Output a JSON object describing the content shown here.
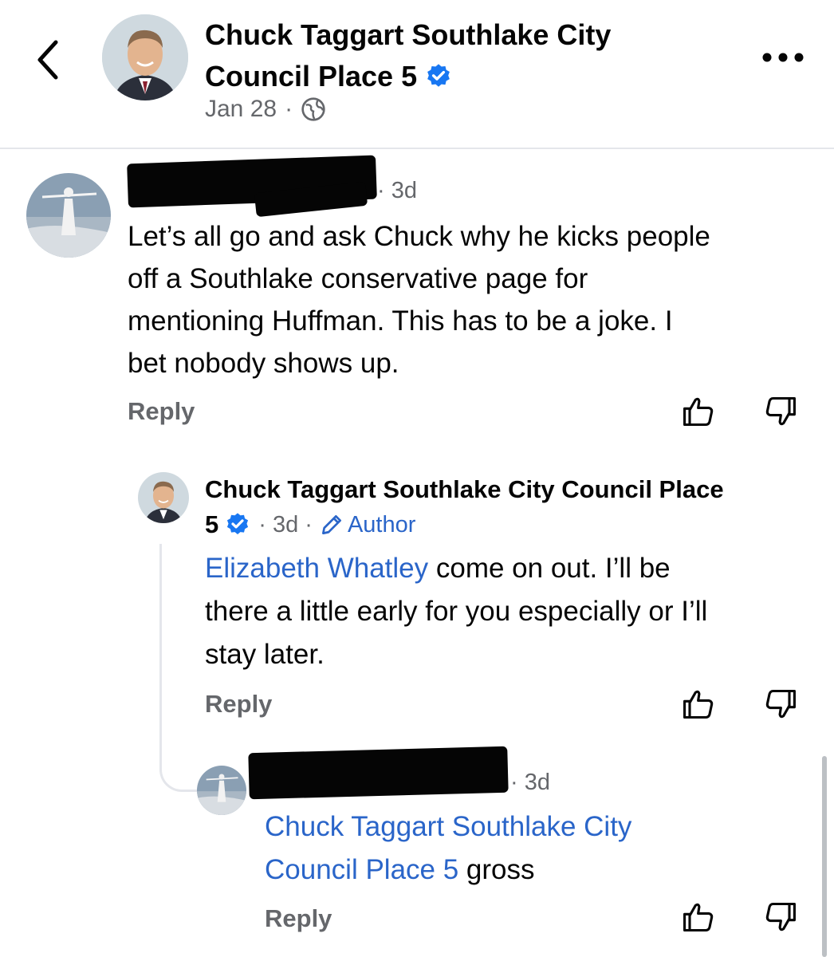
{
  "header": {
    "back_icon": "chevron-left-icon",
    "page_name": "Chuck Taggart Southlake City Council Place 5",
    "name_line1": "Chuck Taggart Southlake City",
    "name_line2": "Council Place 5",
    "date": "Jan 28",
    "separator": "·",
    "audience_icon": "globe-icon",
    "more_icon": "more-icon"
  },
  "comments": [
    {
      "author": "[redacted]",
      "time": "· 3d",
      "lines": [
        "Let’s all go and ask Chuck why he kicks people",
        "off a Southlake conservative page for",
        "mentioning Huffman. This has to be a joke. I",
        "bet nobody shows up."
      ],
      "reply_label": "Reply",
      "like_icon": "thumbs-up-icon",
      "dislike_icon": "thumbs-down-icon"
    },
    {
      "author_line1": "Chuck Taggart Southlake City Council Place",
      "author_line2": "5",
      "time": "· 3d ·",
      "badge": "Author",
      "mention": "Elizabeth Whatley",
      "line1_rest": " come on out. I’ll be",
      "line2": "there a little early for you especially or I’ll",
      "line3": "stay later.",
      "reply_label": "Reply"
    },
    {
      "author": "[redacted]",
      "time": "· 3d",
      "mention_line1": "Chuck Taggart Southlake City",
      "mention_line2": "Council Place 5",
      "text_rest": " gross",
      "reply_label": "Reply"
    }
  ],
  "colors": {
    "link_blue": "#2a65c9",
    "verified_blue": "#1877f2",
    "meta_grey": "#65676b"
  }
}
